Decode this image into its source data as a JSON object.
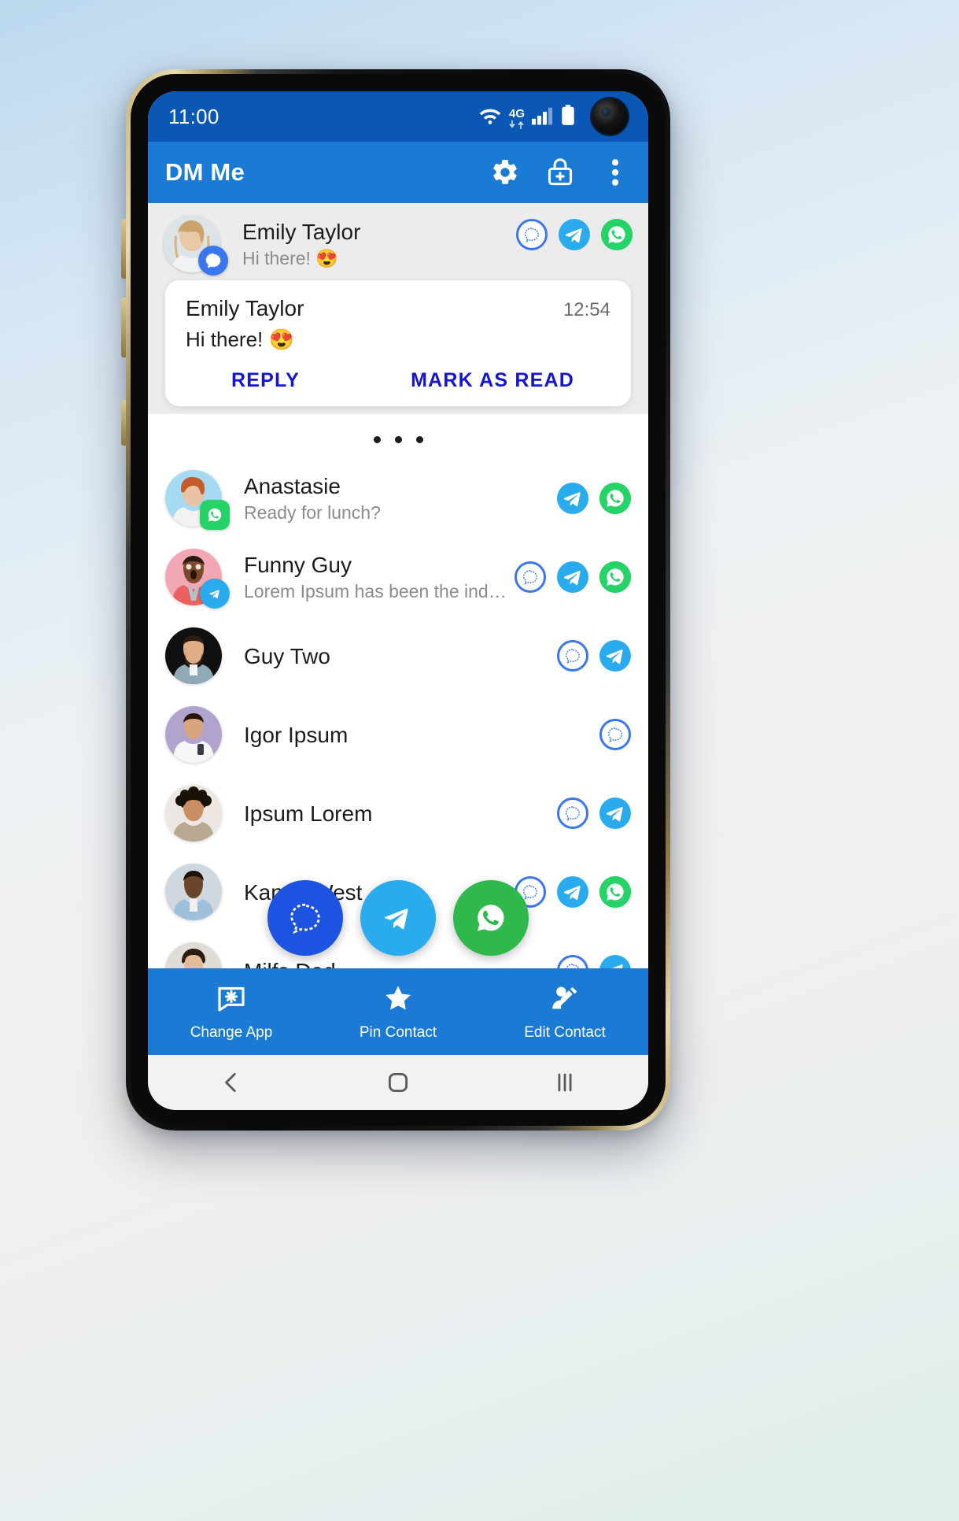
{
  "status_bar": {
    "time": "11:00",
    "network_label": "4G",
    "icons": [
      "wifi-icon",
      "network-4g-icon",
      "cellular-signal-icon",
      "battery-icon",
      "front-camera-lens"
    ]
  },
  "app_bar": {
    "title": "DM Me",
    "actions": [
      {
        "name": "settings-gear-icon",
        "label": "Settings"
      },
      {
        "name": "add-lock-contact-icon",
        "label": "Add Locked Contact"
      },
      {
        "name": "overflow-menu-icon",
        "label": "More options"
      }
    ]
  },
  "notification_preview": {
    "name": "Emily Taylor",
    "message": "Hi there! 😍",
    "source_badge": "signal",
    "apps": [
      "signal",
      "telegram",
      "whatsapp"
    ]
  },
  "notification_card": {
    "name": "Emily Taylor",
    "time": "12:54",
    "message": "Hi there! 😍",
    "reply_label": "REPLY",
    "mark_read_label": "MARK AS READ",
    "action_color": "#1414d2"
  },
  "separator": {
    "dots": 3
  },
  "contacts": [
    {
      "name": "Anastasie",
      "message": "Ready for lunch?",
      "badge": "whatsapp",
      "avatar_bg": "#a6daf2",
      "apps": [
        "telegram",
        "whatsapp"
      ]
    },
    {
      "name": "Funny Guy",
      "message": "Lorem Ipsum has been the industry…",
      "badge": "telegram",
      "avatar_bg": "#f2a8b4",
      "apps": [
        "signal",
        "telegram",
        "whatsapp"
      ]
    },
    {
      "name": "Guy Two",
      "message": "",
      "badge": "",
      "avatar_bg": "#101010",
      "apps": [
        "signal",
        "telegram"
      ]
    },
    {
      "name": "Igor Ipsum",
      "message": "",
      "badge": "",
      "avatar_bg": "#b0a4cf",
      "apps": [
        "signal"
      ]
    },
    {
      "name": "Ipsum Lorem",
      "message": "",
      "badge": "",
      "avatar_bg": "#ece7e2",
      "apps": [
        "signal",
        "telegram"
      ]
    },
    {
      "name": "Kanye West",
      "message": "",
      "badge": "",
      "avatar_bg": "#cfd8de",
      "apps": [
        "signal",
        "telegram",
        "whatsapp"
      ]
    },
    {
      "name": "Milfs Dad",
      "message": "",
      "badge": "",
      "avatar_bg": "#e0dcd6",
      "apps": [
        "signal",
        "telegram"
      ]
    }
  ],
  "floating_actions": [
    {
      "name": "signal",
      "label": "Signal",
      "color": "#1c53e0"
    },
    {
      "name": "telegram",
      "label": "Telegram",
      "color": "#2aabee"
    },
    {
      "name": "whatsapp",
      "label": "WhatsApp",
      "color": "#2fb94d"
    }
  ],
  "bottom_bar": {
    "items": [
      {
        "icon": "change-app-icon",
        "label": "Change App"
      },
      {
        "icon": "star-icon",
        "label": "Pin Contact"
      },
      {
        "icon": "edit-contact-icon",
        "label": "Edit Contact"
      }
    ],
    "background": "#1a7ad4"
  },
  "nav_bar": {
    "items": [
      {
        "icon": "back-icon",
        "label": "Back"
      },
      {
        "icon": "home-icon",
        "label": "Home"
      },
      {
        "icon": "recents-icon",
        "label": "Recents"
      }
    ]
  },
  "theme": {
    "status_bar_bg": "#0b57b5",
    "app_bar_bg": "#1a7ad4",
    "signal_blue": "#3a76f0",
    "telegram_blue": "#2aabee",
    "whatsapp_green": "#25d366"
  }
}
